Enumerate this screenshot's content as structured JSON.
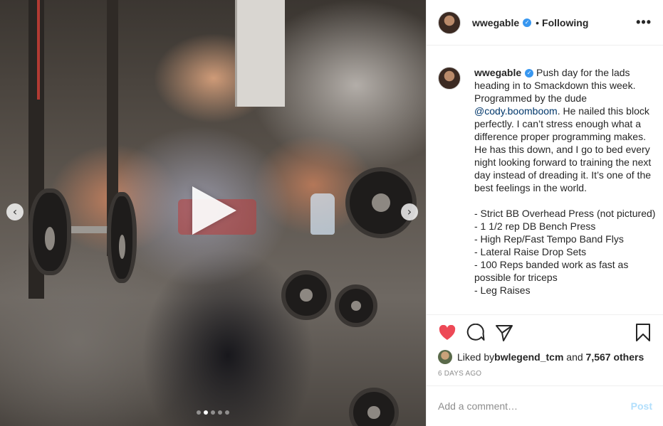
{
  "post": {
    "username": "wwegable",
    "separator": "•",
    "follow_status": "Following",
    "more_icon": "more-horizontal-icon"
  },
  "media": {
    "type": "video-carousel",
    "carousel_count": 5,
    "active_index": 1,
    "prev_glyph": "‹",
    "next_glyph": "›"
  },
  "caption": {
    "username": "wwegable",
    "text_intro": " Push day for the lads heading in to Smackdown this week. Programmed by the dude ",
    "mention": "@cody.boomboom",
    "text_rest": ". He nailed this block perfectly. I can’t stress enough what a difference proper programming makes. He has this down, and I go to bed every night looking forward to training the next day instead of dreading it. It’s one of the best feelings in the world.\n\n- Strict BB Overhead Press (not pictured)\n- 1 1/2 rep DB Bench Press\n- High Rep/Fast Tempo Band Flys\n- Lateral Raise Drop Sets\n- 100 Reps banded work as fast as possible for triceps\n- Leg Raises"
  },
  "likes": {
    "prefix": "Liked by ",
    "first_liker": "bwlegend_tcm",
    "middle": " and ",
    "others": "7,567 others"
  },
  "timestamp": "6 DAYS AGO",
  "comment": {
    "placeholder": "Add a comment…",
    "post_label": "Post"
  },
  "colors": {
    "liked_heart": "#ed4956",
    "verified": "#3897f0",
    "post_disabled": "#b2dffc"
  }
}
